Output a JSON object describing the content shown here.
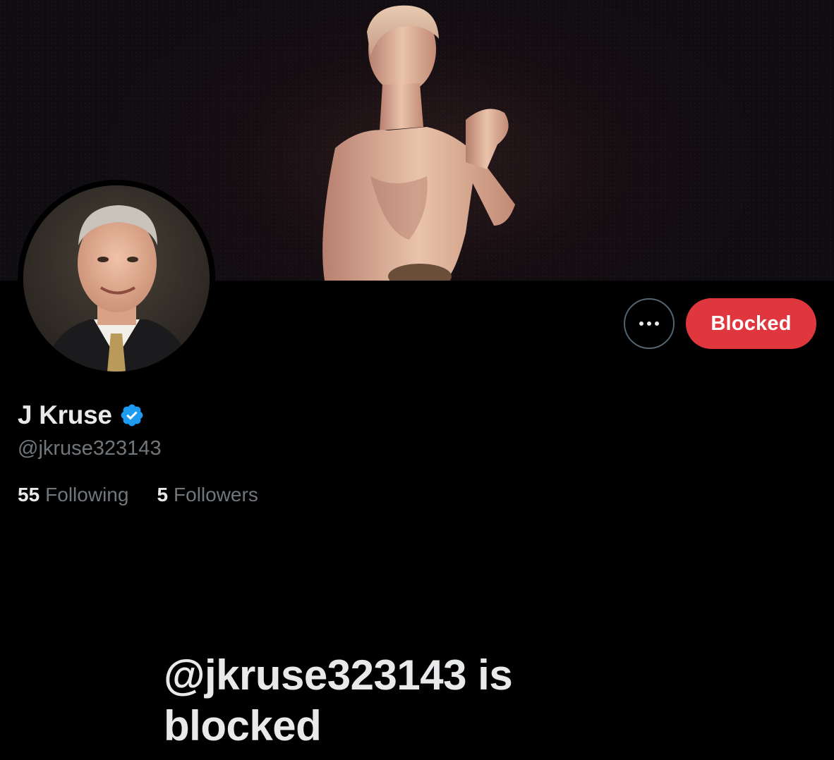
{
  "profile": {
    "display_name": "J Kruse",
    "handle": "@jkruse323143",
    "verified": true
  },
  "actions": {
    "more_icon": "more-horizontal-icon",
    "blocked_label": "Blocked"
  },
  "stats": {
    "following_count": "55",
    "following_label": "Following",
    "followers_count": "5",
    "followers_label": "Followers"
  },
  "blocked_notice": {
    "title": "@jkruse323143 is blocked"
  },
  "colors": {
    "background": "#000000",
    "primary_text": "#e7e9ea",
    "secondary_text": "#71767b",
    "blocked_red": "#e0373e",
    "verified_blue": "#1d9bf0"
  }
}
